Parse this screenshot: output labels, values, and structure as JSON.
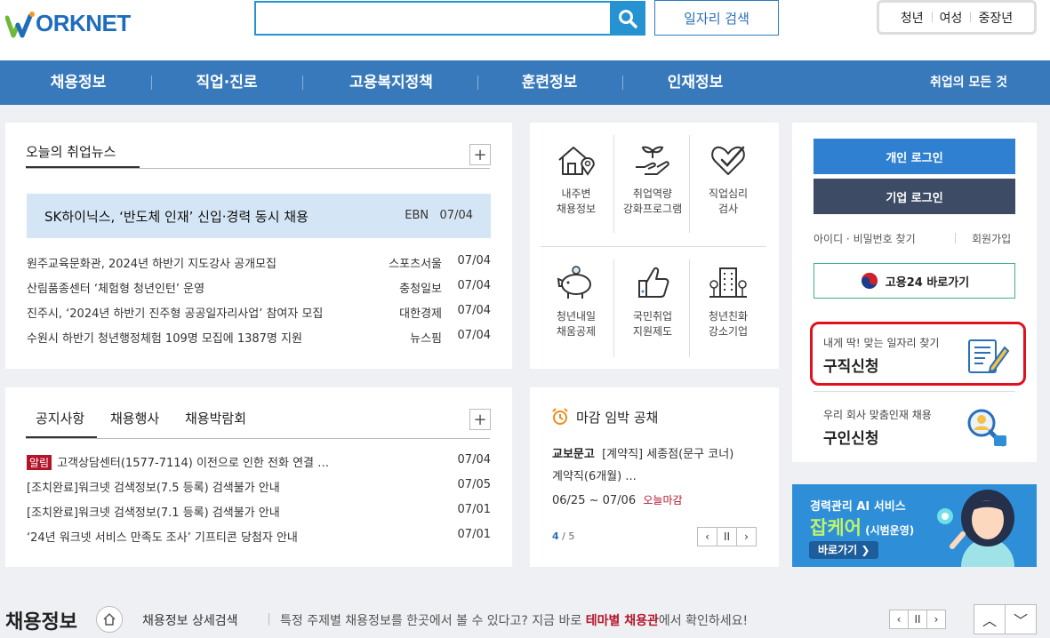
{
  "header": {
    "logo_text": "ORKNET",
    "search_placeholder": "",
    "search_button_icon": "search-icon",
    "job_search_label": "일자리 검색",
    "audience_tabs": [
      "청년",
      "여성",
      "중장년"
    ]
  },
  "nav": {
    "items": [
      "채용정보",
      "직업·진로",
      "고용복지정책",
      "훈련정보",
      "인재정보"
    ],
    "right_label": "취업의 모든 것"
  },
  "news": {
    "title": "오늘의 취업뉴스",
    "headline": {
      "text": "SK하이닉스, ‘반도체 인재’ 신입·경력 동시 채용",
      "source": "EBN",
      "date": "07/04"
    },
    "items": [
      {
        "text": "원주교육문화관, 2024년 하반기 지도강사 공개모집",
        "source": "스포츠서울",
        "date": "07/04"
      },
      {
        "text": "산림품종센터 ‘체험형 청년인턴’ 운영",
        "source": "충청일보",
        "date": "07/04"
      },
      {
        "text": "진주시, ‘2024년 하반기 진주형 공공일자리사업’ 참여자 모집",
        "source": "대한경제",
        "date": "07/04"
      },
      {
        "text": "수원시 하반기 청년행정체험 109명 모집에 1387명 지원",
        "source": "뉴스핌",
        "date": "07/04"
      }
    ]
  },
  "notice": {
    "tabs": [
      "공지사항",
      "채용행사",
      "채용박람회"
    ],
    "badge": "알림",
    "items": [
      {
        "text": "고객상담센터(1577-7114) 이전으로 인한 전화 연결 …",
        "date": "07/04"
      },
      {
        "text": "[조치완료]워크넷 검색정보(7.5 등록) 검색불가 안내",
        "date": "07/05"
      },
      {
        "text": "[조치완료]워크넷 검색정보(7.1 등록) 검색불가 안내",
        "date": "07/01"
      },
      {
        "text": "‘24년 워크넷 서비스 만족도 조사’ 기프티콘 당첨자 안내",
        "date": "07/01"
      }
    ]
  },
  "quick_menu": [
    {
      "line1": "내주변",
      "line2": "채용정보",
      "icon": "house-location-icon"
    },
    {
      "line1": "취업역량",
      "line2": "강화프로그램",
      "icon": "hand-sprout-icon"
    },
    {
      "line1": "직업심리",
      "line2": "검사",
      "icon": "heart-check-icon"
    },
    {
      "line1": "청년내일",
      "line2": "채움공제",
      "icon": "piggy-bank-icon"
    },
    {
      "line1": "국민취업",
      "line2": "지원제도",
      "icon": "thumbs-up-icon"
    },
    {
      "line1": "청년친화",
      "line2": "강소기업",
      "icon": "building-icon"
    }
  ],
  "deadline": {
    "title": "마감 임박 공채",
    "company": "교보문고",
    "desc1": "[계약직] 세종점(문구 코너)",
    "desc2": "계약직(6개월) ...",
    "period": "06/25 ~ 07/06",
    "status": "오늘마감",
    "page_current": "4",
    "page_total": "/ 5"
  },
  "login": {
    "personal": "개인 로그인",
    "company": "기업 로그인",
    "find": "아이디 · 비밀번호 찾기",
    "join": "회원가입",
    "goyong24": "고용24 바로가기"
  },
  "apply": {
    "sub": "내게 딱! 맞는 일자리 찾기",
    "main": "구직신청"
  },
  "recruit": {
    "sub": "우리 회사 맞춤인재 채용",
    "main": "구인신청"
  },
  "banner": {
    "line1": "경력관리 AI 서비스",
    "big": "잡케어",
    "small": "(시범운영)",
    "button": "바로가기"
  },
  "bottom": {
    "title": "채용정보",
    "link": "채용정보 상세검색",
    "text_before": "특정 주제별 채용정보를 한곳에서 볼 수 있다고? 지금 바로 ",
    "highlight": "테마별 채용관",
    "text_after": "에서 확인하세요!"
  },
  "colors": {
    "nav_bg": "#3879bb",
    "accent_blue": "#2593d1",
    "login_personal": "#2f80d0",
    "login_company": "#3d4b65",
    "alert_red": "#e0101e",
    "badge_red": "#b3142a"
  }
}
